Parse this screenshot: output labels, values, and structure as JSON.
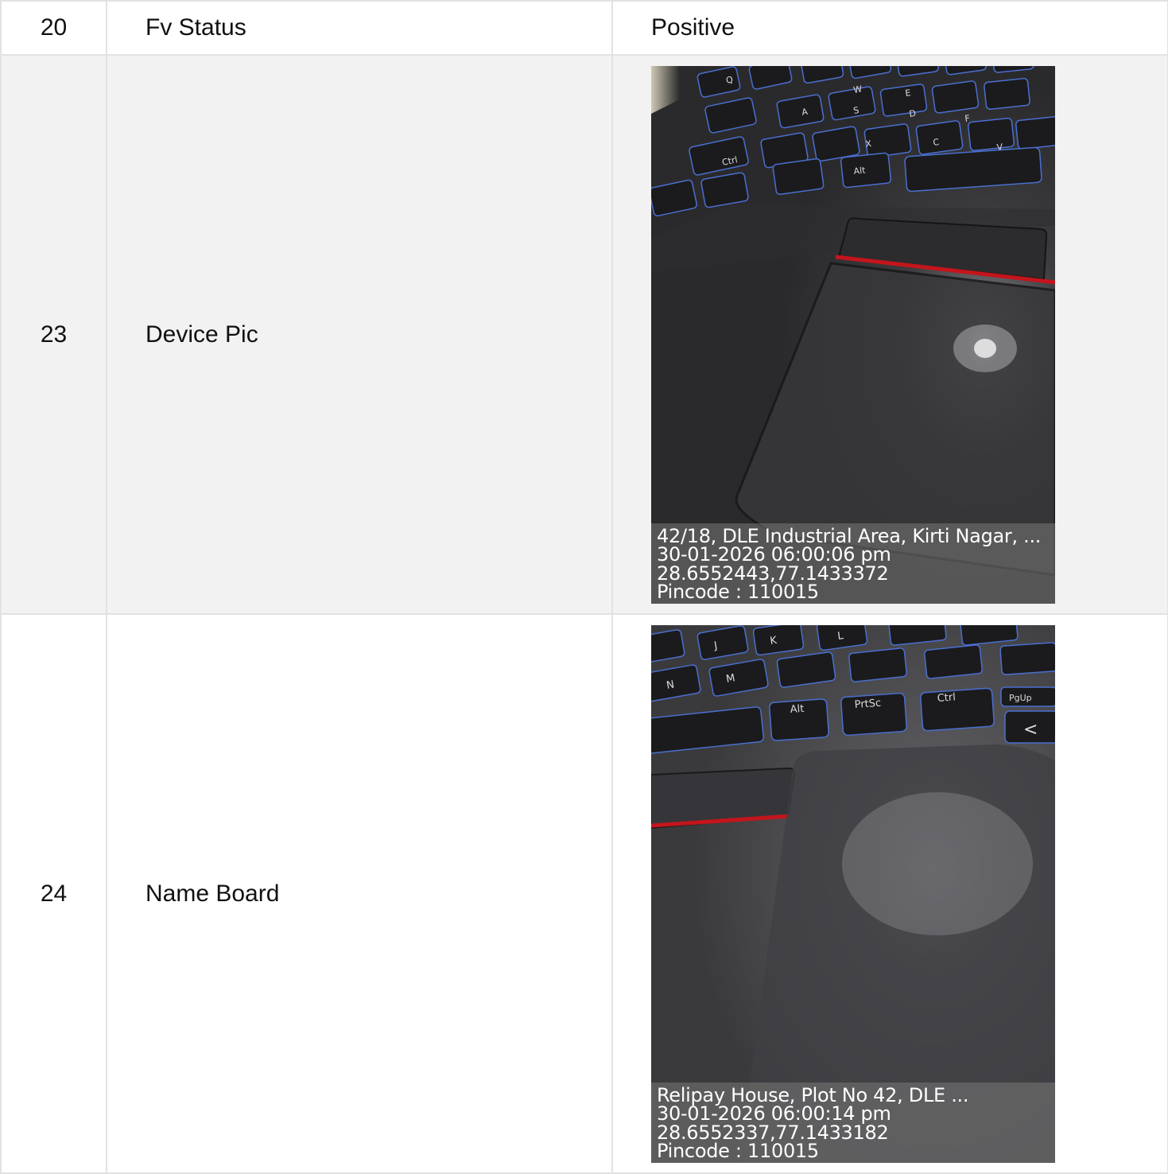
{
  "rows": [
    {
      "num": "20",
      "label": "Fv Status",
      "value": "Positive"
    },
    {
      "num": "23",
      "label": "Device Pic",
      "photo": {
        "subject": "laptop-keyboard-touchpad",
        "overlay": [
          "42/18, DLE Industrial Area, Kirti Nagar, ...",
          "30-01-2026 06:00:06 pm",
          "28.6552443,77.1433372",
          "Pincode : 110015"
        ]
      }
    },
    {
      "num": "24",
      "label": "Name Board",
      "photo": {
        "subject": "laptop-keyboard-touchpad",
        "overlay": [
          "Relipay House, Plot No 42, DLE ...",
          "30-01-2026 06:00:14 pm",
          "28.6552337,77.1433182",
          "Pincode : 110015"
        ]
      }
    }
  ],
  "colors": {
    "border": "#e2e2e2",
    "shaded_row": "#f2f2f2",
    "trackpad_stripe": "#c4151c"
  }
}
